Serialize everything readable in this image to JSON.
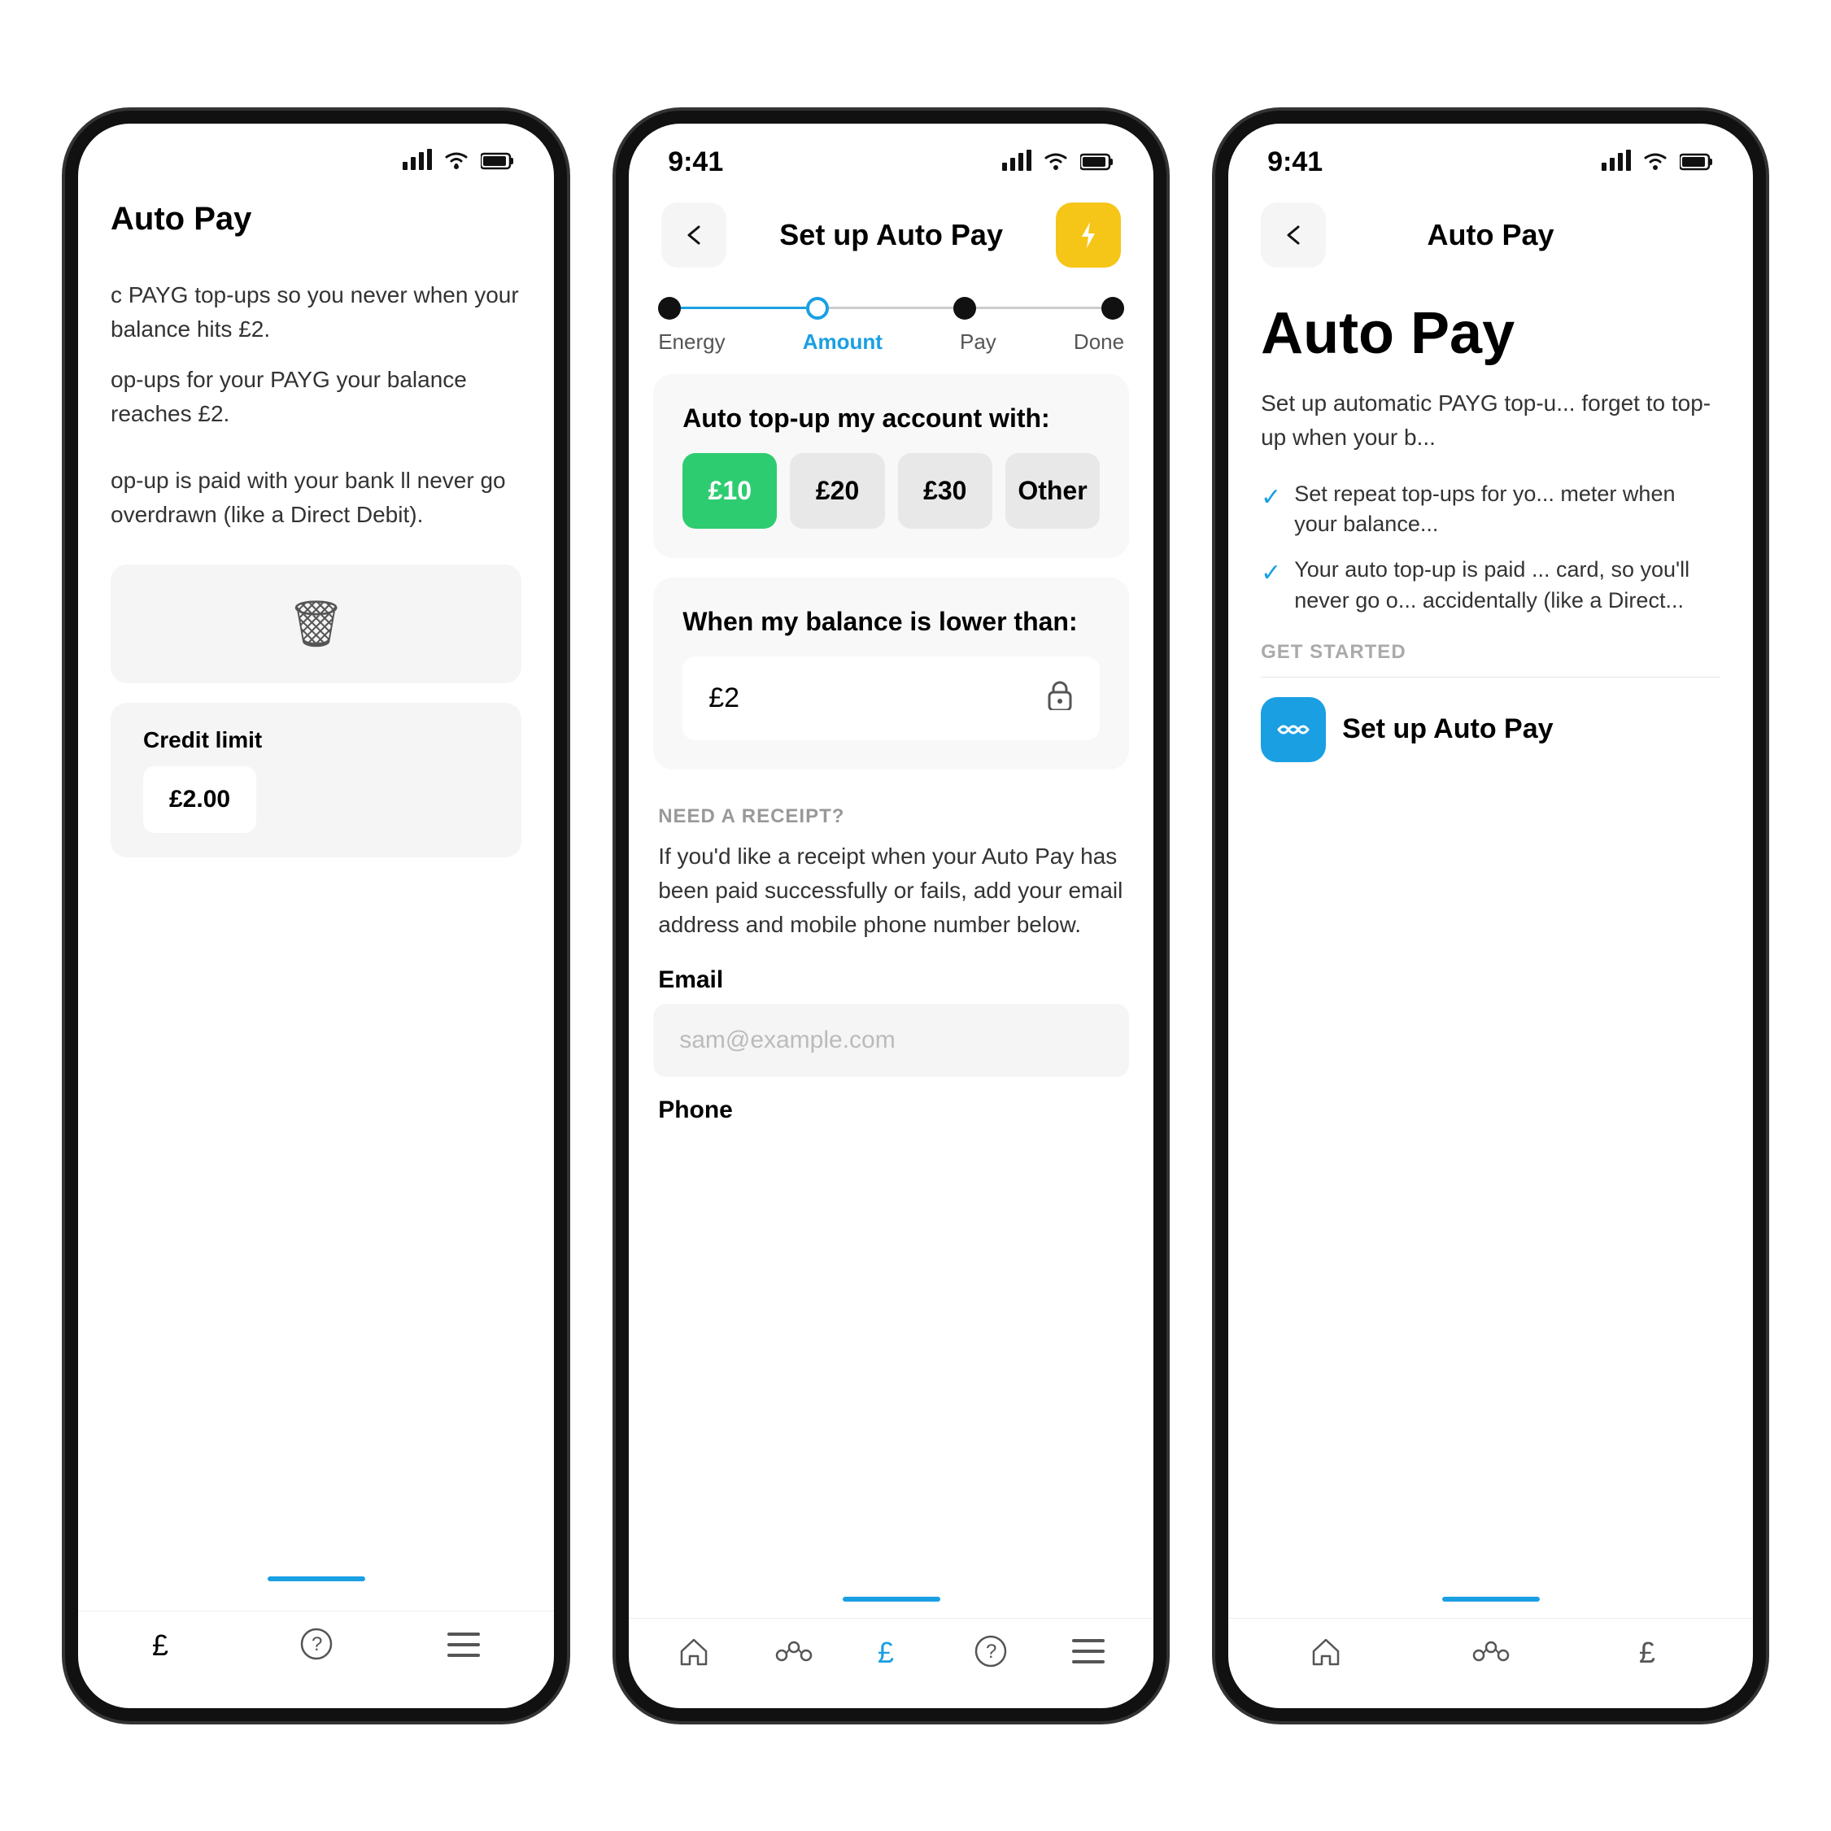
{
  "phones": {
    "left": {
      "header": {
        "title": "Auto Pay"
      },
      "content": {
        "desc1": "c PAYG top-ups so you never when your balance hits £2.",
        "desc2": "op-ups for your PAYG your balance reaches £2.",
        "desc3": "op-up is paid with your bank ll never go overdrawn (like a Direct Debit).",
        "deleteIcon": "🗑",
        "creditLimitLabel": "Credit limit",
        "creditLimitValue": "£2.00"
      },
      "bottomNav": {
        "items": [
          "£",
          "?",
          "≡"
        ]
      }
    },
    "center": {
      "statusBar": {
        "time": "9:41"
      },
      "header": {
        "backLabel": "←",
        "title": "Set up Auto Pay",
        "actionIcon": "⚡"
      },
      "stepper": {
        "steps": [
          {
            "label": "Energy",
            "state": "done"
          },
          {
            "label": "Amount",
            "state": "active"
          },
          {
            "label": "Pay",
            "state": "inactive"
          },
          {
            "label": "Done",
            "state": "inactive"
          }
        ]
      },
      "topUpCard": {
        "title": "Auto top-up my account with:",
        "options": [
          {
            "label": "£10",
            "selected": true
          },
          {
            "label": "£20",
            "selected": false
          },
          {
            "label": "£30",
            "selected": false
          },
          {
            "label": "Other",
            "selected": false
          }
        ]
      },
      "balanceCard": {
        "title": "When my balance is lower than:",
        "value": "£2",
        "lockIcon": "🔒"
      },
      "receiptSection": {
        "sectionLabel": "NEED A RECEIPT?",
        "description": "If you'd like a receipt when your Auto Pay has been paid successfully or fails, add your email address and mobile phone number below.",
        "emailLabel": "Email",
        "emailPlaceholder": "sam@example.com",
        "phoneLabel": "Phone"
      },
      "bottomNav": {
        "items": [
          "🏠",
          "⬡",
          "£",
          "?",
          "≡"
        ]
      }
    },
    "right": {
      "statusBar": {
        "time": "9:41"
      },
      "header": {
        "backLabel": "←",
        "title": "Auto Pay"
      },
      "content": {
        "bigTitle": "Auto Pay",
        "description": "Set up automatic PAYG top-u... forget to top-up when your b...",
        "checkItems": [
          "Set repeat top-ups for yo... meter when your balance...",
          "Your auto top-up is paid ... card, so you'll never go o... accidentally (like a Direct..."
        ],
        "getStartedLabel": "GET STARTED",
        "setupButtonLabel": "Set up Auto Pay",
        "setupButtonIcon": "∞"
      },
      "bottomNav": {
        "items": [
          "🏠",
          "⬡",
          "£"
        ]
      }
    }
  }
}
